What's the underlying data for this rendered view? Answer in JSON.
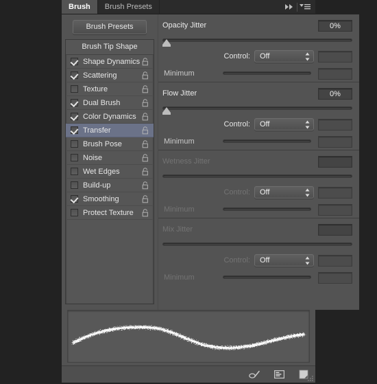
{
  "window": {
    "title": "Brush"
  },
  "tabs": [
    {
      "label": "Brush",
      "active": true
    },
    {
      "label": "Brush Presets",
      "active": false
    }
  ],
  "tab_icons": [
    {
      "name": "collapse-to-icons-icon",
      "glyph": "▶▶"
    },
    {
      "name": "panel-menu-icon",
      "glyph": "▼≡"
    }
  ],
  "sidebar": {
    "presets_button": "Brush Presets",
    "list_header": "Brush Tip Shape",
    "items": [
      {
        "label": "Shape Dynamics",
        "checked": true,
        "selected": false,
        "locked": false
      },
      {
        "label": "Scattering",
        "checked": true,
        "selected": false,
        "locked": false
      },
      {
        "label": "Texture",
        "checked": false,
        "selected": false,
        "locked": false
      },
      {
        "label": "Dual Brush",
        "checked": true,
        "selected": false,
        "locked": false
      },
      {
        "label": "Color Dynamics",
        "checked": true,
        "selected": false,
        "locked": false
      },
      {
        "label": "Transfer",
        "checked": true,
        "selected": true,
        "locked": false
      },
      {
        "label": "Brush Pose",
        "checked": false,
        "selected": false,
        "locked": false
      },
      {
        "label": "Noise",
        "checked": false,
        "selected": false,
        "locked": false
      },
      {
        "label": "Wet Edges",
        "checked": false,
        "selected": false,
        "locked": false
      },
      {
        "label": "Build-up",
        "checked": false,
        "selected": false,
        "locked": false
      },
      {
        "label": "Smoothing",
        "checked": true,
        "selected": false,
        "locked": false
      },
      {
        "label": "Protect Texture",
        "checked": false,
        "selected": false,
        "locked": false
      }
    ]
  },
  "sections": [
    {
      "title": "Opacity Jitter",
      "value": "0%",
      "slider_pct": 0,
      "enabled": true,
      "control_label": "Control:",
      "control_value": "Off",
      "control_field": "",
      "minimum_label": "Minimum",
      "minimum_value": "",
      "minimum_enabled": false
    },
    {
      "title": "Flow Jitter",
      "value": "0%",
      "slider_pct": 0,
      "enabled": true,
      "control_label": "Control:",
      "control_value": "Off",
      "control_field": "",
      "minimum_label": "Minimum",
      "minimum_value": "",
      "minimum_enabled": false
    },
    {
      "title": "Wetness Jitter",
      "value": "",
      "slider_pct": 0,
      "enabled": false,
      "control_label": "Control:",
      "control_value": "Off",
      "control_field": "",
      "minimum_label": "Minimum",
      "minimum_value": "",
      "minimum_enabled": false
    },
    {
      "title": "Mix Jitter",
      "value": "",
      "slider_pct": 0,
      "enabled": false,
      "control_label": "Control:",
      "control_value": "Off",
      "control_field": "",
      "minimum_label": "Minimum",
      "minimum_value": "",
      "minimum_enabled": false
    }
  ],
  "preview": {
    "name": "brush-stroke-preview"
  },
  "footer_icons": [
    {
      "name": "toggle-brush-options-icon"
    },
    {
      "name": "create-new-brush-from-settings-icon"
    },
    {
      "name": "new-brush-preset-icon"
    }
  ],
  "colors": {
    "panel_bg": "#535353",
    "app_bg": "#222222",
    "tabbar_bg": "#2b2b2b",
    "selection": "#6b7288",
    "text": "#e6e6e6",
    "text_disabled": "#737373"
  }
}
